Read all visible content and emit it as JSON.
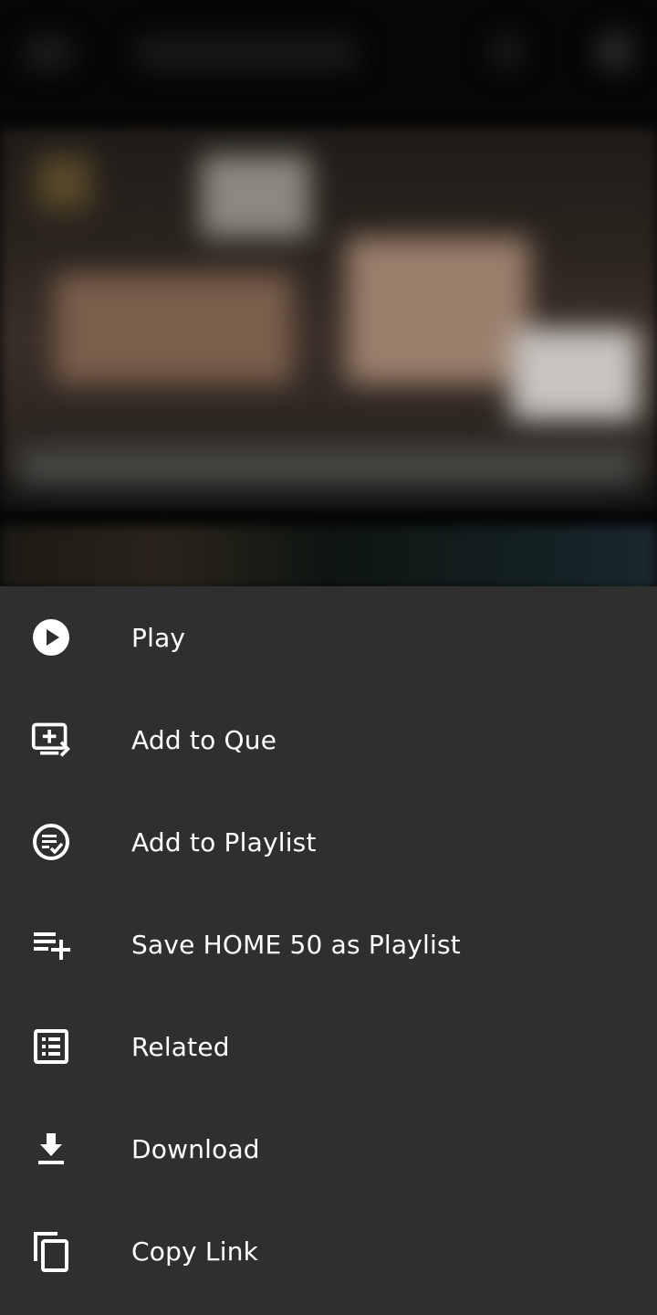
{
  "sheet": {
    "items": [
      {
        "label": "Play",
        "icon": "play-circle-icon"
      },
      {
        "label": "Add to Que",
        "icon": "add-to-queue-icon"
      },
      {
        "label": "Add to Playlist",
        "icon": "playlist-check-icon"
      },
      {
        "label": "Save HOME 50 as Playlist",
        "icon": "playlist-add-icon"
      },
      {
        "label": "Related",
        "icon": "list-icon"
      },
      {
        "label": "Download",
        "icon": "download-icon"
      },
      {
        "label": "Copy Link",
        "icon": "copy-icon"
      }
    ]
  },
  "colors": {
    "sheet_background": "#2f2f2f",
    "text": "#ffffff",
    "icon": "#ffffff"
  }
}
